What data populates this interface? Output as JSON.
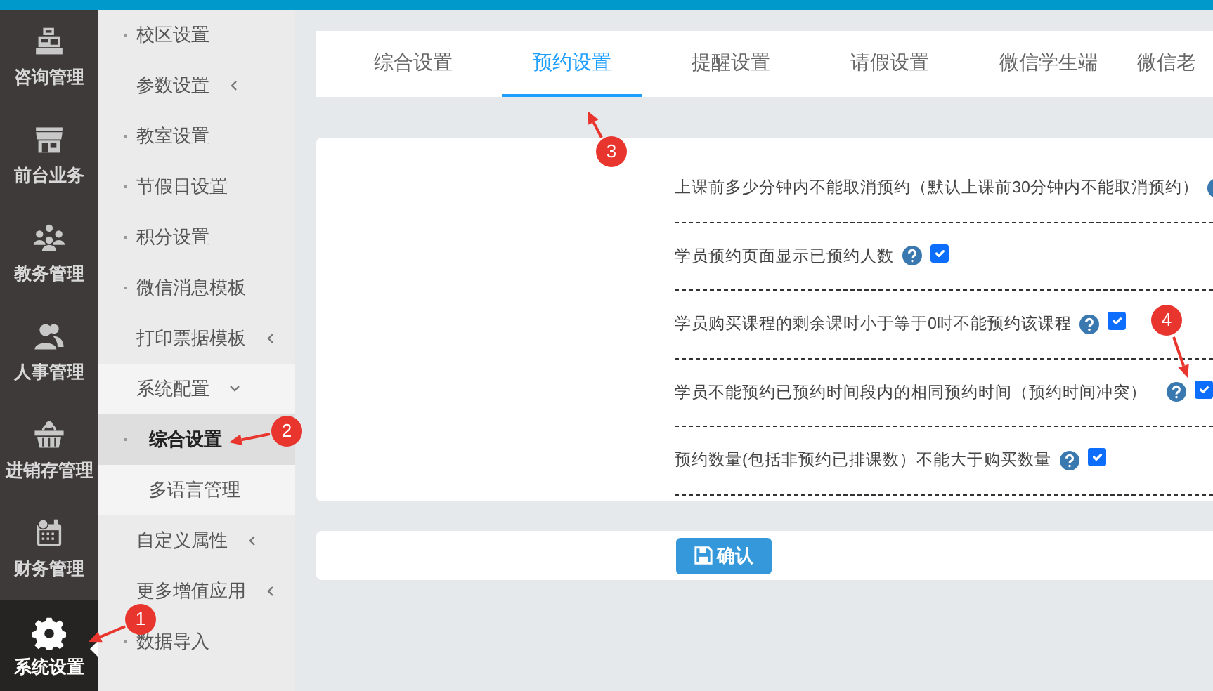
{
  "main_nav": [
    {
      "label": "咨询管理",
      "selected": false
    },
    {
      "label": "前台业务",
      "selected": false
    },
    {
      "label": "教务管理",
      "selected": false
    },
    {
      "label": "人事管理",
      "selected": false
    },
    {
      "label": "进销存管理",
      "selected": false
    },
    {
      "label": "财务管理",
      "selected": false
    },
    {
      "label": "系统设置",
      "selected": true
    }
  ],
  "sub_nav": [
    {
      "kind": "link",
      "label": "校区设置",
      "selected": false
    },
    {
      "kind": "group",
      "label": "参数设置",
      "expanded": false
    },
    {
      "kind": "link",
      "label": "教室设置",
      "selected": false
    },
    {
      "kind": "link",
      "label": "节假日设置",
      "selected": false
    },
    {
      "kind": "link",
      "label": "积分设置",
      "selected": false
    },
    {
      "kind": "link",
      "label": "微信消息模板",
      "selected": false
    },
    {
      "kind": "group",
      "label": "打印票据模板",
      "expanded": false
    },
    {
      "kind": "group",
      "label": "系统配置",
      "expanded": true,
      "children": [
        {
          "label": "综合设置",
          "selected": true
        },
        {
          "label": "多语言管理",
          "selected": false
        }
      ]
    },
    {
      "kind": "group",
      "label": "自定义属性",
      "expanded": false
    },
    {
      "kind": "group",
      "label": "更多增值应用",
      "expanded": false
    },
    {
      "kind": "link",
      "label": "数据导入",
      "selected": false
    }
  ],
  "tabs": [
    {
      "label": "综合设置",
      "selected": false
    },
    {
      "label": "预约设置",
      "selected": true
    },
    {
      "label": "提醒设置",
      "selected": false
    },
    {
      "label": "请假设置",
      "selected": false
    },
    {
      "label": "微信学生端",
      "selected": false
    },
    {
      "label": "微信老",
      "selected": false
    }
  ],
  "settings": [
    {
      "label": "上课前多少分钟内不能取消预约（默认上课前30分钟内不能取消预约）"
    },
    {
      "label": "学员预约页面显示已预约人数",
      "checked": true
    },
    {
      "label": "学员购买课程的剩余课时小于等于0时不能预约该课程",
      "checked": true
    },
    {
      "label": "学员不能预约已预约时间段内的相同预约时间（预约时间冲突）",
      "checked": true
    },
    {
      "label": "预约数量(包括非预约已排课数）不能大于购买数量",
      "checked": true
    }
  ],
  "confirm_button": {
    "label": "确认"
  },
  "annotations": [
    {
      "label": "1"
    },
    {
      "label": "2"
    },
    {
      "label": "3"
    },
    {
      "label": "4"
    }
  ]
}
